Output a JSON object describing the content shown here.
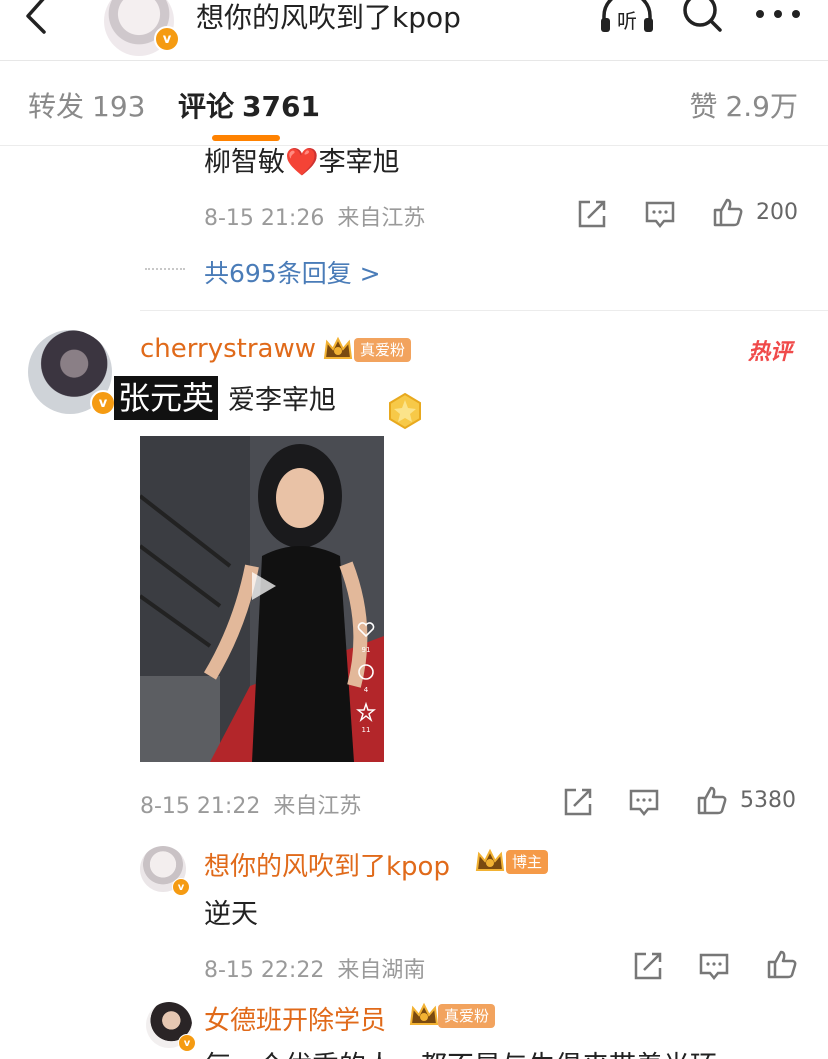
{
  "header": {
    "title": "想你的风吹到了kpop",
    "listen_label": "听",
    "avatar_badge": "v"
  },
  "tabs": {
    "repost": {
      "label": "转发",
      "count": "193"
    },
    "comment": {
      "label": "评论",
      "count": "3761"
    },
    "like": {
      "label": "赞",
      "count": "2.9万"
    }
  },
  "prev_comment": {
    "text": "柳智敏❤️李宰旭",
    "time": "8-15 21:26",
    "location": "来自江苏",
    "likes": "200",
    "reply_link": "共695条回复 >"
  },
  "main_comment": {
    "username": "cherrystraww",
    "fan_badge": "真爱粉",
    "hot_tag": "热评",
    "cover_text": "张元英",
    "text": "爱李宰旭",
    "time": "8-15 21:22",
    "location": "来自江苏",
    "likes": "5380",
    "video_counts": [
      "91",
      "4",
      "11"
    ]
  },
  "reply1": {
    "username": "想你的风吹到了kpop",
    "badge": "博主",
    "text": "逆天",
    "time": "8-15 22:22",
    "location": "来自湖南"
  },
  "reply2": {
    "username": "女德班开除学员",
    "badge": "真爱粉",
    "text": "每一个优秀的人，都不是与生俱来带着光环"
  },
  "colors": {
    "accent": "#ff8200",
    "username": "#e06a1a",
    "link": "#4a7cb8",
    "hot": "#f04a4a"
  }
}
